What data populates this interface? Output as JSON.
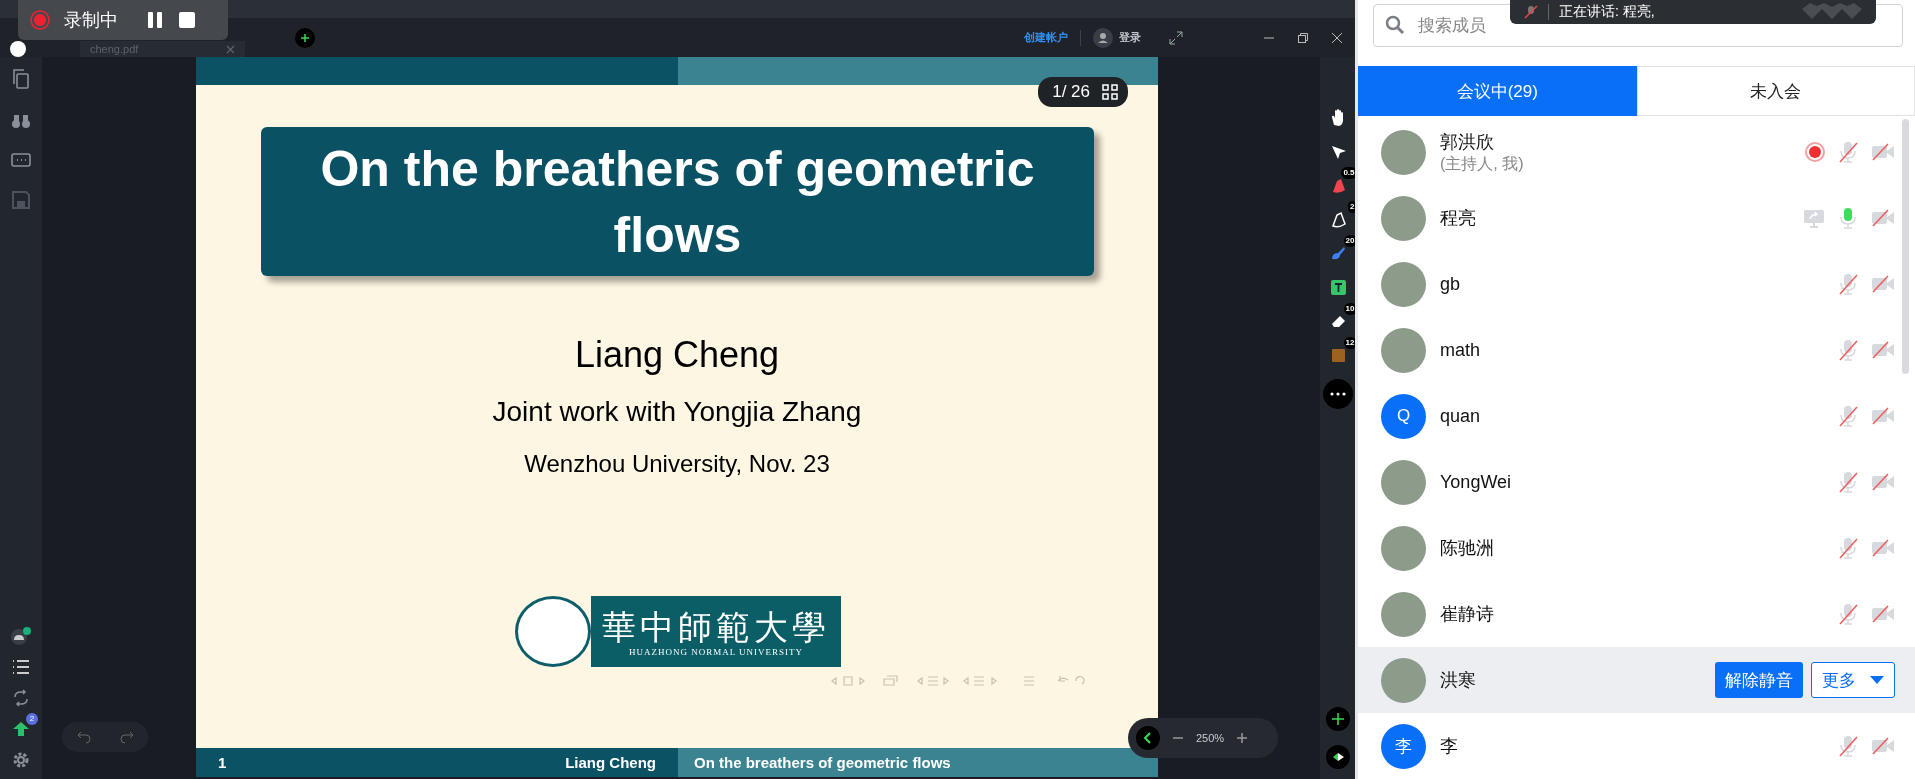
{
  "recording": {
    "label": "录制中"
  },
  "tab": {
    "label": "cheng.pdf"
  },
  "account": {
    "create": "创建帐户",
    "login": "登录"
  },
  "slide": {
    "title": "On the breathers of geometric flows",
    "author": "Liang Cheng",
    "subtitle": "Joint work with Yongjia Zhang",
    "venue": "Wenzhou University, Nov. 23",
    "logo_chinese": "華中師範大學",
    "logo_english": "HUAZHONG NORMAL UNIVERSITY",
    "page": "1/ 26",
    "footer": {
      "page": "1",
      "author": "Liang Cheng",
      "title": "On the breathers of geometric flows"
    }
  },
  "zoom": "250%",
  "tools": [
    {
      "kind": "hand"
    },
    {
      "kind": "pointer"
    },
    {
      "kind": "highlighter",
      "badge": "0.5"
    },
    {
      "kind": "pen",
      "badge": "2"
    },
    {
      "kind": "brush",
      "badge": "20"
    },
    {
      "kind": "text"
    },
    {
      "kind": "eraser",
      "badge": "10"
    },
    {
      "kind": "shape",
      "badge": "12"
    }
  ],
  "upload_badge": "2",
  "toast": {
    "text": "正在讲话: 程亮,"
  },
  "members": {
    "search_placeholder": "搜索成员",
    "tabs": [
      {
        "label": "会议中(29)",
        "selected": true
      },
      {
        "label": "未入会",
        "selected": false
      }
    ],
    "list": [
      {
        "kind": "idle",
        "name": "郭洪欣",
        "note": "(主持人, 我)",
        "recording": true,
        "sharing": false,
        "mic_muted": true,
        "camera_off": true
      },
      {
        "kind": "idle",
        "name": "程亮",
        "recording": false,
        "sharing": true,
        "mic_muted": false,
        "camera_off": true
      },
      {
        "kind": "idle",
        "name": "gb",
        "recording": false,
        "sharing": false,
        "mic_muted": true,
        "camera_off": true
      },
      {
        "kind": "idle",
        "name": "math",
        "recording": false,
        "sharing": false,
        "mic_muted": true,
        "camera_off": true
      },
      {
        "kind": "idle",
        "name": "quan",
        "initial": "Q",
        "recording": false,
        "sharing": false,
        "mic_muted": true,
        "camera_off": true
      },
      {
        "kind": "idle",
        "name": "YongWei",
        "recording": false,
        "sharing": false,
        "mic_muted": true,
        "camera_off": true
      },
      {
        "kind": "idle",
        "name": "陈驰洲",
        "recording": false,
        "sharing": false,
        "mic_muted": true,
        "camera_off": true
      },
      {
        "kind": "idle",
        "name": "崔静诗",
        "recording": false,
        "sharing": false,
        "mic_muted": true,
        "camera_off": true
      },
      {
        "kind": "hovered",
        "name": "洪寒",
        "actions": [
          "解除静音",
          "更多"
        ]
      },
      {
        "kind": "idle",
        "name": "李",
        "initial": "李",
        "recording": false,
        "sharing": false,
        "mic_muted": true,
        "camera_off": true
      }
    ]
  }
}
